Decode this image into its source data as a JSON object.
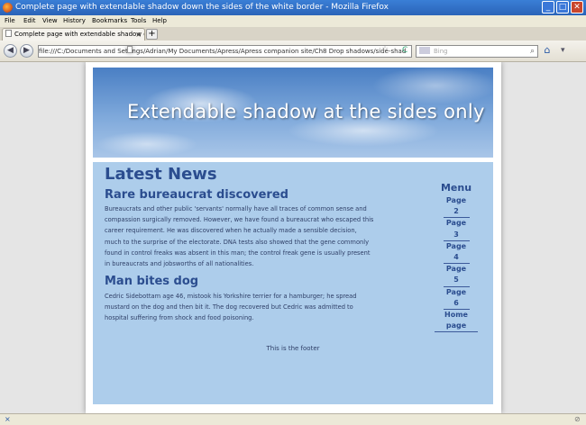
{
  "window": {
    "title": "Complete page with extendable shadow down the sides of the white border - Mozilla Firefox",
    "minimize": "_",
    "maximize": "□",
    "close": "✕"
  },
  "menubar": [
    "File",
    "Edit",
    "View",
    "History",
    "Bookmarks",
    "Tools",
    "Help"
  ],
  "tab": {
    "label": "Complete page with extendable shadow do...",
    "close": "×",
    "new_tab": "+"
  },
  "nav": {
    "back": "◀",
    "forward": "▶",
    "url": "file:///C:/Documents and Settings/Adrian/My Documents/Apress/Apress companion site/Ch8 Drop shadows/side-shad",
    "star": "☆",
    "reload": "C",
    "search_placeholder": "Bing",
    "search_icon": "⌕",
    "home": "⌂",
    "addons": "▾"
  },
  "page": {
    "banner_title": "Extendable shadow at the sides only",
    "heading": "Latest News",
    "articles": [
      {
        "title": "Rare bureaucrat discovered",
        "body": "Bureaucrats and other public 'servants' normally have all traces of common sense and compassion surgically removed. However, we have found a bureaucrat who escaped this career requirement. He was discovered when he actually made a sensible decision, much to the surprise of the electorate. DNA tests also showed that the gene commonly found in control freaks was absent in this man; the control freak gene is usually present in bureaucrats and jobsworths of all nationalities."
      },
      {
        "title": "Man bites dog",
        "body": "Cedric Sidebottam age 46, mistook his Yorkshire terrier for a hamburger; he spread mustard on the dog and then bit it.  The dog recovered but Cedric was admitted to hospital suffering from shock and food poisoning."
      }
    ],
    "menu": {
      "title": "Menu",
      "items": [
        "Page 2",
        "Page 3",
        "Page 4",
        "Page 5",
        "Page 6",
        "Home page"
      ]
    },
    "footer": "This is the footer"
  },
  "status": {
    "left": "×",
    "right": "⊘"
  }
}
